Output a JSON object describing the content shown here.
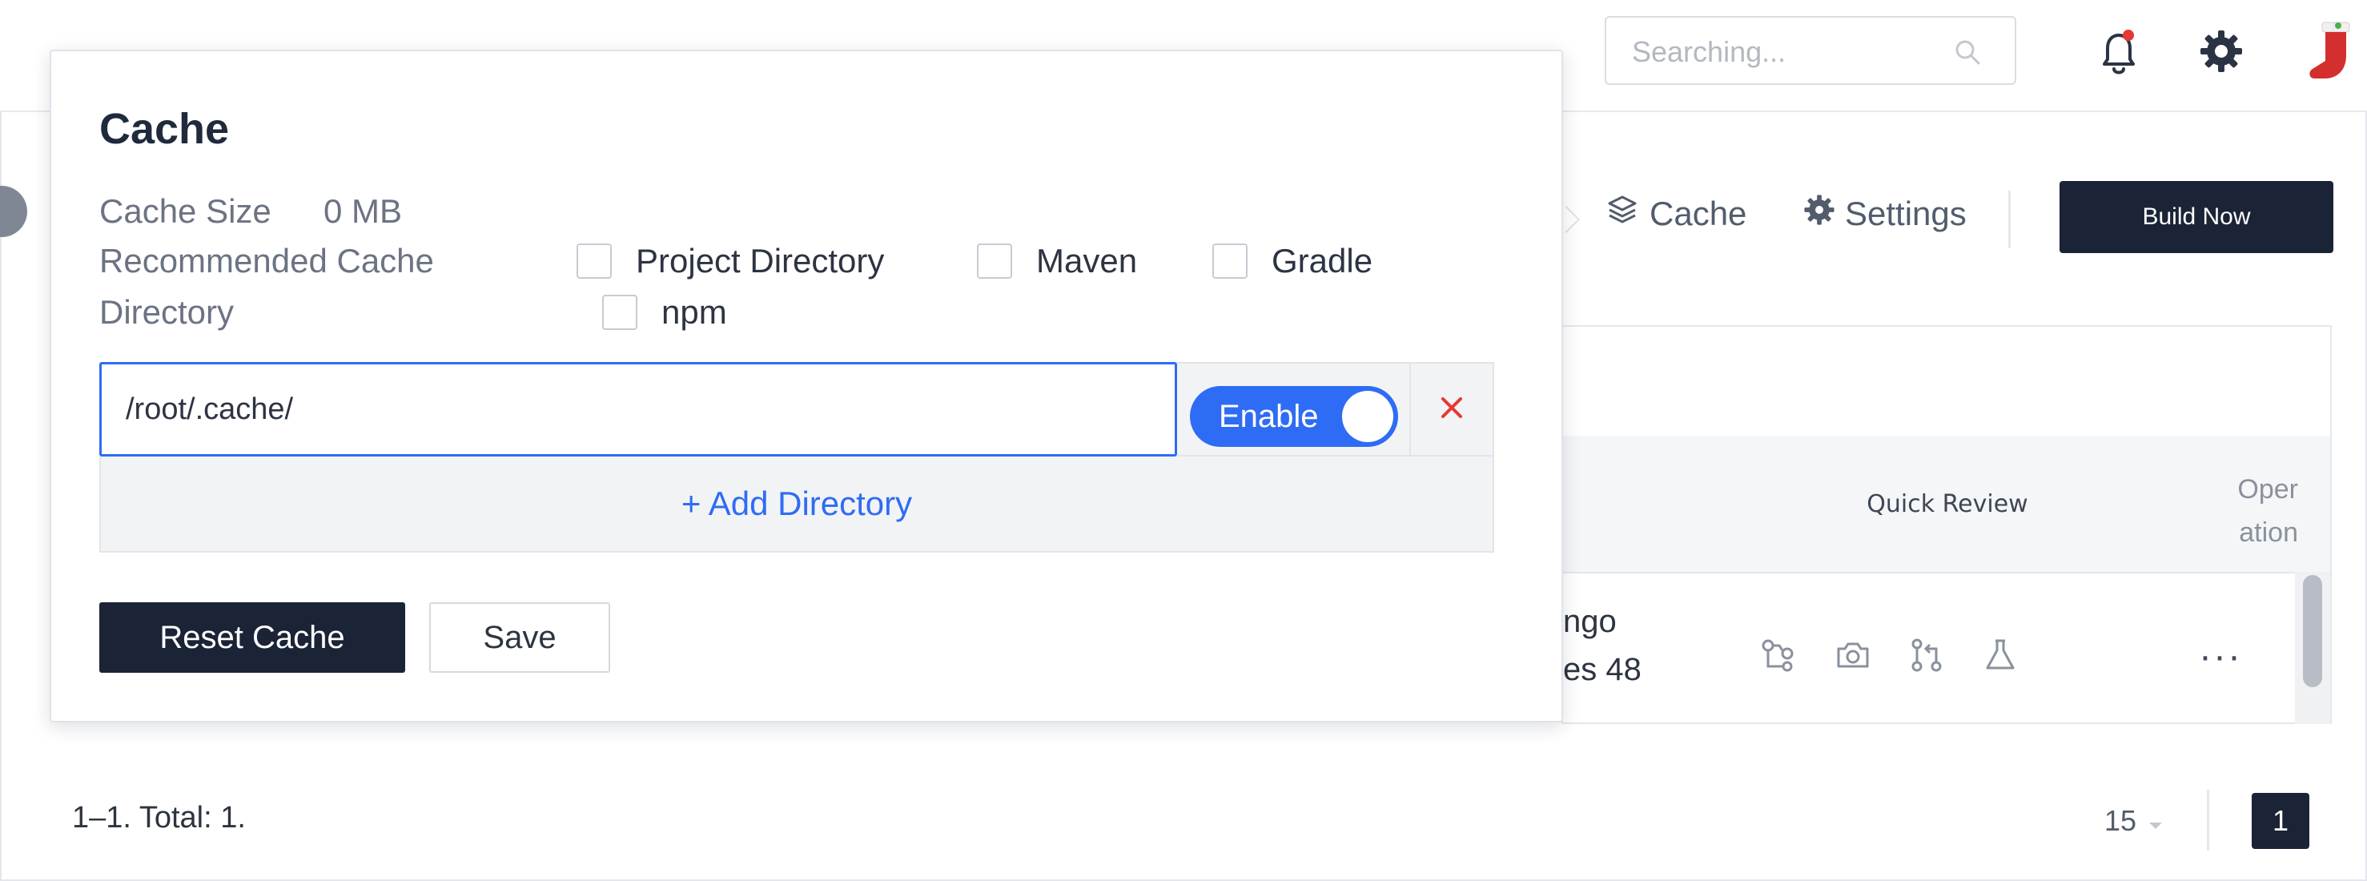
{
  "header": {
    "search": {
      "placeholder": "Searching...",
      "value": ""
    },
    "icons": [
      "bell-icon",
      "gear-icon",
      "stocking-avatar-icon"
    ],
    "notification_dot_color": "#e53935"
  },
  "toolbar": {
    "cache_label": "Cache",
    "settings_label": "Settings",
    "build_label": "Build Now"
  },
  "table": {
    "columns": {
      "quick_review": "Quick Review",
      "operation_line1": "Oper",
      "operation_line2": "ation"
    },
    "row": {
      "text_line1": "ngo",
      "text_line2": "es 48",
      "quick_icons": [
        "workflow-icon",
        "camera-icon",
        "pull-request-icon",
        "flask-icon"
      ],
      "more_label": "···"
    }
  },
  "pagination": {
    "total_label": "1–1. Total: 1.",
    "page_size": "15",
    "current_page": "1"
  },
  "cache_popover": {
    "title": "Cache",
    "size_label": "Cache Size",
    "size_value": "0 MB",
    "recommended_label_line1": "Recommended Cache",
    "recommended_label_line2": "Directory",
    "options": [
      {
        "label": "Project Directory",
        "checked": false
      },
      {
        "label": "Maven",
        "checked": false
      },
      {
        "label": "Gradle",
        "checked": false
      },
      {
        "label": "npm",
        "checked": false
      }
    ],
    "directory": {
      "value": "/root/.cache/",
      "toggle_label": "Enable",
      "enabled": true
    },
    "add_directory_label": "+ Add Directory",
    "reset_label": "Reset Cache",
    "save_label": "Save"
  },
  "colors": {
    "accent": "#2f6cf5",
    "dark": "#1b2336",
    "danger": "#e53935"
  }
}
